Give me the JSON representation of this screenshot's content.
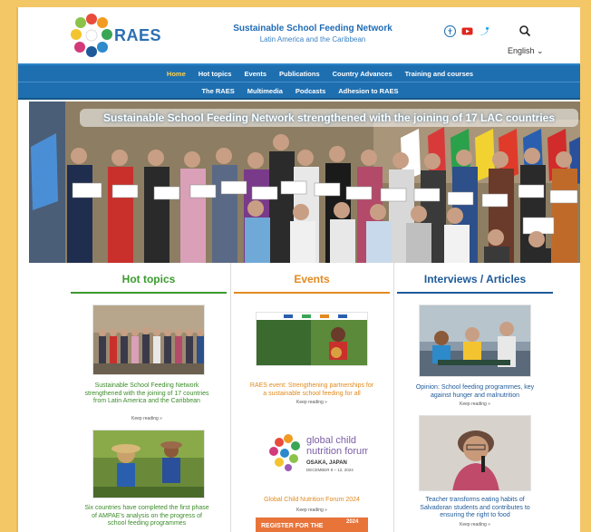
{
  "header": {
    "logo_text": "RAES",
    "site_title": "Sustainable School Feeding Network",
    "site_subtitle": "Latin America and the Caribbean",
    "language": "English ⌄"
  },
  "nav": {
    "row1": [
      "Home",
      "Hot topics",
      "Events",
      "Publications",
      "Country Advances",
      "Training and courses"
    ],
    "row2": [
      "The RAES",
      "Multimedia",
      "Podcasts",
      "Adhesion to RAES"
    ],
    "active": "Home"
  },
  "hero": {
    "banner": "Sustainable School Feeding Network strengthened with the joining of 17 LAC countries"
  },
  "columns": {
    "hot_topics": {
      "title": "Hot topics",
      "items": [
        {
          "caption": "Sustainable School Feeding Network strengthened with the joining of 17 countries from Latin America and the Caribbean",
          "more": "Keep reading »"
        },
        {
          "caption": "Six countries have completed the first phase of AMPAE's analysis on the progress of school feeding programmes",
          "more": ""
        }
      ]
    },
    "events": {
      "title": "Events",
      "items": [
        {
          "caption": "RAES event: Strengthening partnerships for a sustainable school feeding for all",
          "more": "Keep reading »"
        },
        {
          "caption": "Global Child Nutrition Forum 2024",
          "more": "Keep reading »",
          "image_text": [
            "global child",
            "nutrition forum",
            "OSAKA, JAPAN",
            "DECEMBER 9 – 12, 2024"
          ]
        },
        {
          "caption": "",
          "image_text": [
            "REGISTER FOR THE",
            "2024"
          ]
        }
      ]
    },
    "interviews": {
      "title": "Interviews / Articles",
      "items": [
        {
          "caption": "Opinion: School feeding programmes, key against hunger and malnutrition",
          "more": "Keep reading »"
        },
        {
          "caption": "Teacher transforms eating habits of Salvadoran students and contributes to ensuring the right to food",
          "more": "Keep reading »"
        }
      ]
    }
  },
  "colors": {
    "nav_blue": "#1e6fb0",
    "hot_green": "#3c9a2e",
    "events_orange": "#e38a1f",
    "articles_blue": "#1e5a99",
    "active_nav": "#ffd24d"
  }
}
